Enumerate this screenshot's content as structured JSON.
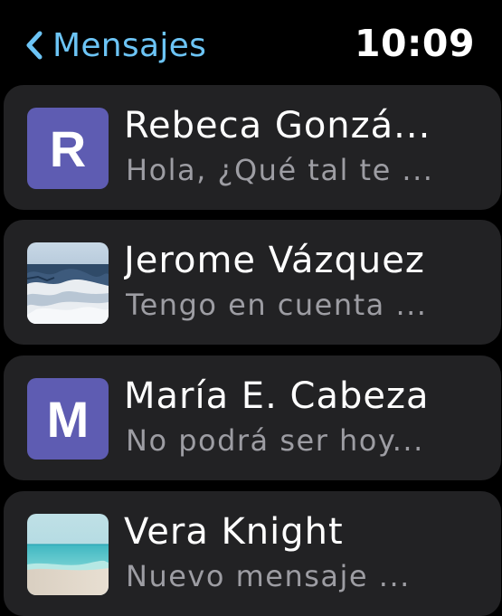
{
  "header": {
    "back_label": "Mensajes",
    "time": "10:09"
  },
  "colors": {
    "accent": "#6cc4f5",
    "cell_background": "#222224",
    "avatar_initial_background": "#5e5cb2",
    "preview_text": "#9d9da3"
  },
  "conversations": [
    {
      "avatar_type": "initial",
      "initial": "R",
      "name": "Rebeca Gonzá...",
      "preview": "Hola, ¿Qué tal te ..."
    },
    {
      "avatar_type": "photo",
      "photo": "snowy-seascape",
      "name": "Jerome Vázquez",
      "preview": "Tengo en cuenta ..."
    },
    {
      "avatar_type": "initial",
      "initial": "M",
      "name": "María E. Cabeza",
      "preview": "No podrá ser hoy..."
    },
    {
      "avatar_type": "photo",
      "photo": "turquoise-beach",
      "name": "Vera Knight",
      "preview": "Nuevo mensaje ..."
    }
  ]
}
